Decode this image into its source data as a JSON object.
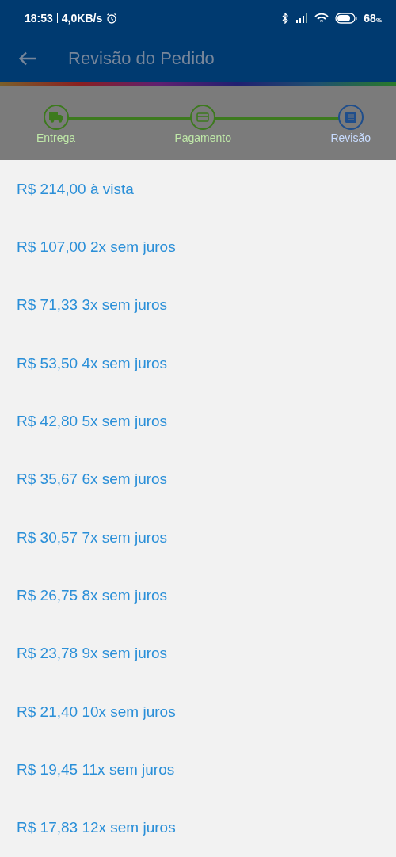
{
  "status_bar": {
    "time": "18:53",
    "speed": "4,0KB/s",
    "battery": "68",
    "battery_unit": "%"
  },
  "app_bar": {
    "title": "Revisão do Pedido"
  },
  "steps": [
    {
      "label": "Entrega",
      "selected": false,
      "kind": "truck"
    },
    {
      "label": "Pagamento",
      "selected": false,
      "kind": "card"
    },
    {
      "label": "Revisão",
      "selected": true,
      "kind": "list"
    }
  ],
  "options": [
    {
      "label": "R$ 214,00 à vista"
    },
    {
      "label": "R$ 107,00 2x sem juros"
    },
    {
      "label": "R$ 71,33 3x sem juros"
    },
    {
      "label": "R$ 53,50 4x sem juros"
    },
    {
      "label": "R$ 42,80 5x sem juros"
    },
    {
      "label": "R$ 35,67 6x sem juros"
    },
    {
      "label": "R$ 30,57 7x sem juros"
    },
    {
      "label": "R$ 26,75 8x sem juros"
    },
    {
      "label": "R$ 23,78 9x sem juros"
    },
    {
      "label": "R$ 21,40 10x sem juros"
    },
    {
      "label": "R$ 19,45 11x sem juros"
    },
    {
      "label": "R$ 17,83 12x sem juros"
    }
  ]
}
